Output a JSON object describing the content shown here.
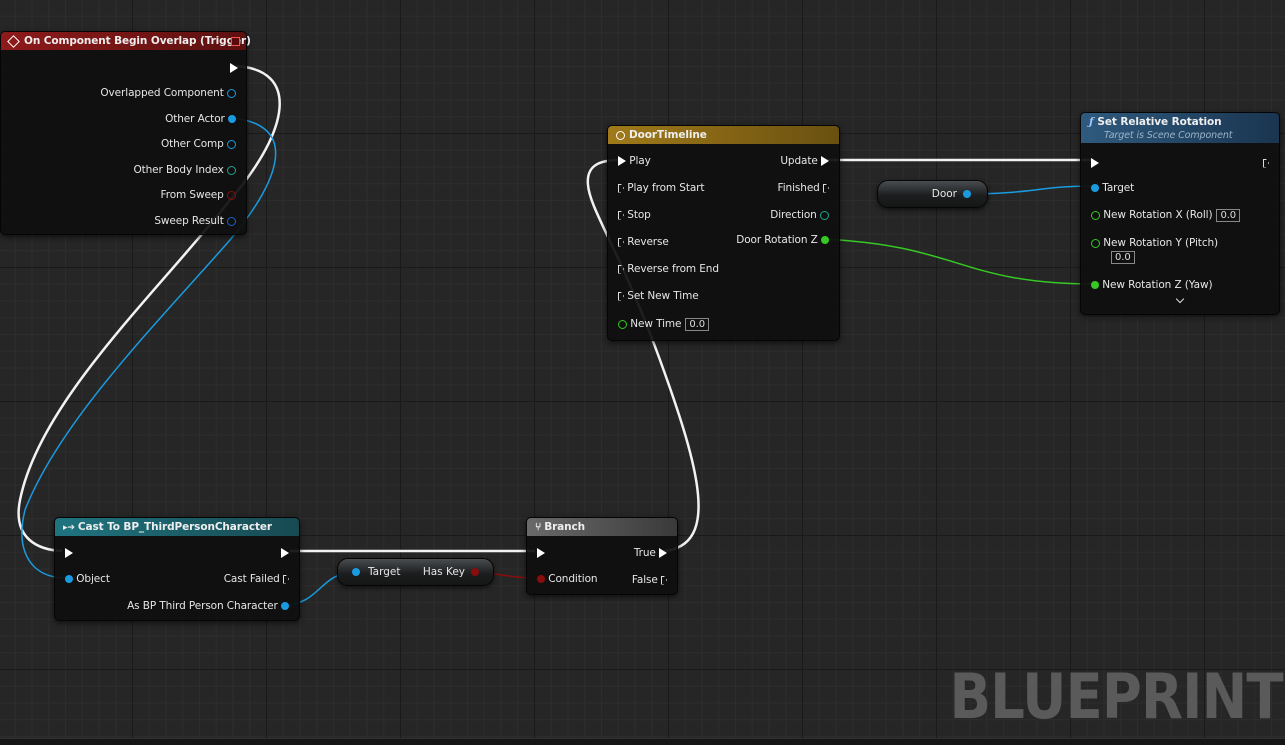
{
  "event_node": {
    "title": "On Component Begin Overlap (Trigger)",
    "pins": [
      "Overlapped Component",
      "Other Actor",
      "Other Comp",
      "Other Body Index",
      "From Sweep",
      "Sweep Result"
    ]
  },
  "timeline_node": {
    "title": "DoorTimeline",
    "inputs": [
      "Play",
      "Play from Start",
      "Stop",
      "Reverse",
      "Reverse from End",
      "Set New Time",
      "New Time"
    ],
    "new_time_value": "0.0",
    "outputs": [
      "Update",
      "Finished",
      "Direction",
      "Door Rotation Z"
    ]
  },
  "door_var": {
    "label": "Door"
  },
  "set_rotation_node": {
    "title": "Set Relative Rotation",
    "subtitle": "Target is Scene Component",
    "pins": [
      "Target",
      "New Rotation X (Roll)",
      "New Rotation Y (Pitch)",
      "New Rotation Z (Yaw)"
    ],
    "roll_value": "0.0",
    "pitch_value": "0.0"
  },
  "cast_node": {
    "title": "Cast To BP_ThirdPersonCharacter",
    "object_pin": "Object",
    "cast_failed": "Cast Failed",
    "as_output": "As BP Third Person Character"
  },
  "haskey_node": {
    "target": "Target",
    "output": "Has Key"
  },
  "branch_node": {
    "title": "Branch",
    "condition": "Condition",
    "true": "True",
    "false": "False"
  },
  "watermark": "BLUEPRINT",
  "colors": {
    "event_header": "#7a1414",
    "timeline_header": "#8a6a14",
    "function_header": "#2a4f6e",
    "cast_header": "#1f6470",
    "branch_header": "#5a5a5a",
    "object_pin": "#1a9be0",
    "float_pin": "#36c824",
    "bool_pin": "#8a0d0d"
  }
}
